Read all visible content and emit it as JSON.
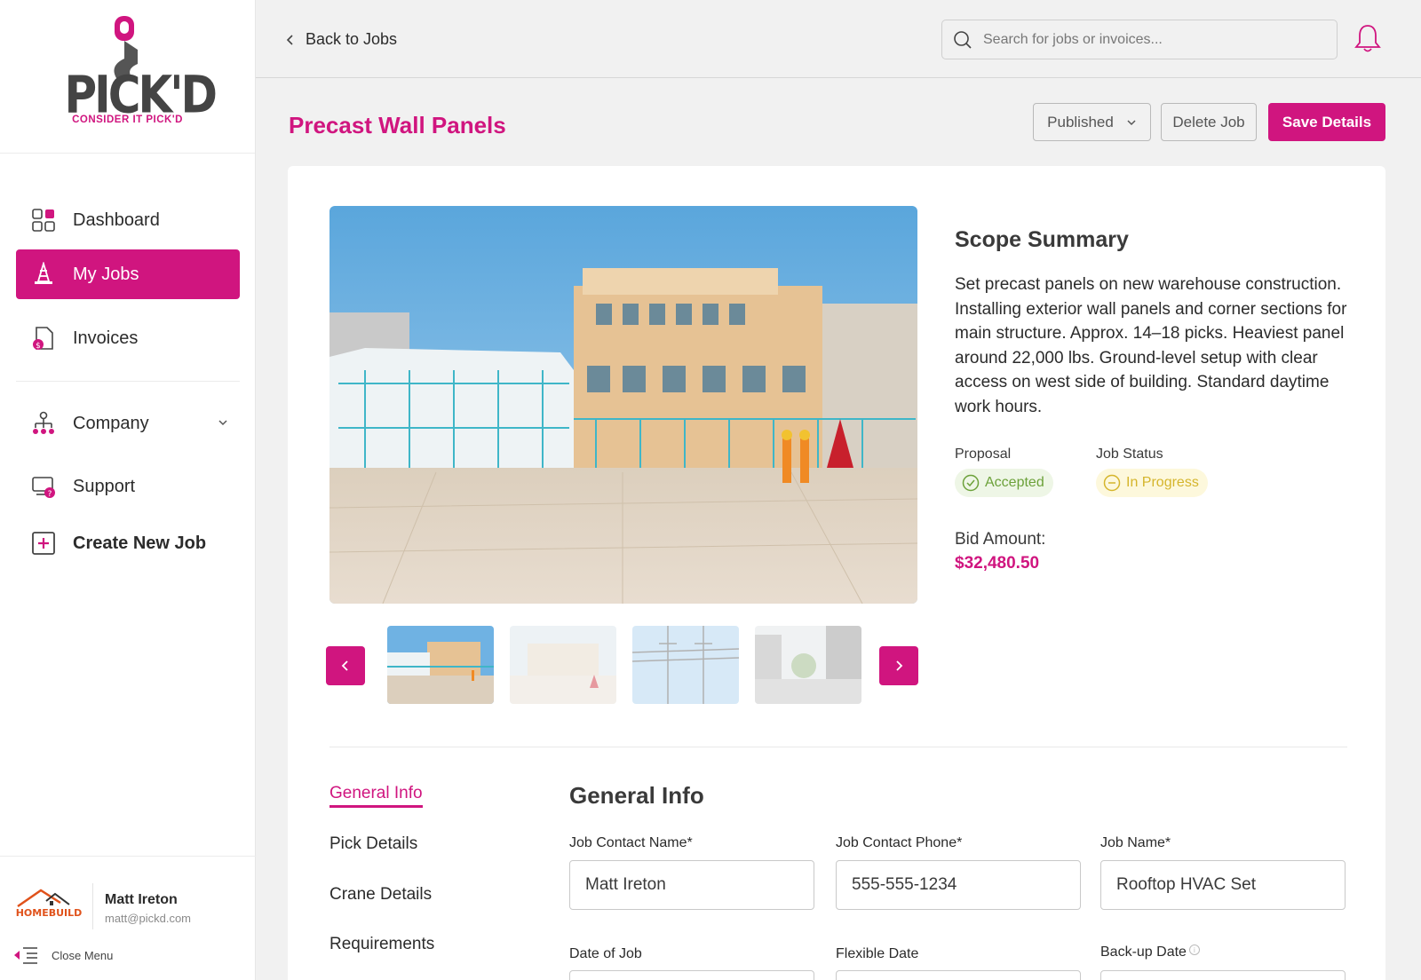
{
  "brand": {
    "name": "PICK'D",
    "tagline": "CONSIDER IT PICK'D",
    "accent_color": "#d0157f"
  },
  "sidebar": {
    "items": [
      {
        "label": "Dashboard",
        "icon": "dashboard-icon"
      },
      {
        "label": "My Jobs",
        "icon": "traffic-cone-icon",
        "active": true
      },
      {
        "label": "Invoices",
        "icon": "invoice-icon"
      },
      {
        "label": "Company",
        "icon": "org-chart-icon"
      },
      {
        "label": "Support",
        "icon": "support-icon"
      },
      {
        "label": "Create New Job",
        "icon": "plus-square-icon"
      }
    ],
    "user": {
      "company_logo_text": "HOMEBUILD",
      "name": "Matt Ireton",
      "email": "matt@pickd.com"
    },
    "close_menu_label": "Close Menu"
  },
  "topbar": {
    "back_label": "Back to Jobs",
    "search_placeholder": "Search for jobs or invoices..."
  },
  "job": {
    "title": "Precast Wall Panels",
    "status_select": "Published",
    "delete_label": "Delete Job",
    "save_label": "Save Details",
    "scope_title": "Scope Summary",
    "scope_text": "Set precast panels on new warehouse construction. Installing exterior wall panels and corner sections for main structure. Approx. 14–18 picks. Heaviest panel around 22,000 lbs. Ground-level setup with clear access on west side of building. Standard daytime work hours.",
    "proposal_label": "Proposal",
    "proposal_value": "Accepted",
    "job_status_label": "Job Status",
    "job_status_value": "In Progress",
    "bid_label": "Bid Amount:",
    "bid_amount": "$32,480.50"
  },
  "section_nav": [
    "General Info",
    "Pick Details",
    "Crane Details",
    "Requirements"
  ],
  "general_info": {
    "title": "General Info",
    "fields": [
      {
        "label": "Job Contact Name*",
        "value": "Matt Ireton"
      },
      {
        "label": "Job Contact Phone*",
        "value": "555-555-1234"
      },
      {
        "label": "Job Name*",
        "value": "Rooftop HVAC Set"
      },
      {
        "label": "Date of Job",
        "value": ""
      },
      {
        "label": "Flexible Date",
        "value": ""
      },
      {
        "label": "Back-up Date",
        "value": ""
      }
    ]
  }
}
